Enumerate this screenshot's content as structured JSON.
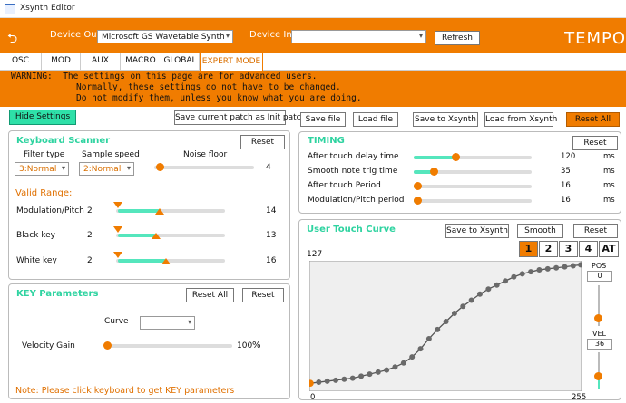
{
  "window": {
    "title": "Xsynth Editor"
  },
  "header": {
    "device_out_label": "Device Out:",
    "device_out_value": "Microsoft GS Wavetable Synth",
    "device_in_label": "Device In:",
    "device_in_value": "",
    "refresh_label": "Refresh",
    "brand": "TEMPO"
  },
  "tabs": [
    "OSC",
    "MOD",
    "AUX",
    "MACRO",
    "GLOBAL",
    "EXPERT MODE"
  ],
  "warning": {
    "line1": "WARNING:  The settings on this page are for advanced users.",
    "line2": "Normally, these settings do not have to be changed.",
    "line3": "Do not modify them, unless you know what you are doing."
  },
  "toolbar": {
    "hide_settings": "Hide Settings",
    "save_init": "Save current patch as Init patch",
    "save_file": "Save file",
    "load_file": "Load file",
    "save_xsynth": "Save to Xsynth",
    "load_xsynth": "Load from Xsynth",
    "reset_all": "Reset All"
  },
  "keyboard_scanner": {
    "title": "Keyboard Scanner",
    "reset": "Reset",
    "filter_type_label": "Filter type",
    "filter_type_value": "3:Normal",
    "sample_speed_label": "Sample speed",
    "sample_speed_value": "2:Normal",
    "noise_floor_label": "Noise floor",
    "noise_floor_value": "4",
    "noise_floor_level": 0.05,
    "valid_range_label": "Valid Range:",
    "ranges": [
      {
        "label": "Modulation/Pitch",
        "min": "2",
        "max": "14",
        "min_level": 0.02,
        "max_level": 0.4
      },
      {
        "label": "Black key",
        "min": "2",
        "max": "13",
        "min_level": 0.02,
        "max_level": 0.37
      },
      {
        "label": "White key",
        "min": "2",
        "max": "16",
        "min_level": 0.02,
        "max_level": 0.46
      }
    ]
  },
  "key_parameters": {
    "title": "KEY Parameters",
    "reset_all": "Reset All",
    "reset": "Reset",
    "curve_label": "Curve",
    "curve_value": "",
    "velocity_gain_label": "Velocity Gain",
    "velocity_gain_value": "100",
    "velocity_gain_unit": "%",
    "velocity_gain_level": 0.0,
    "note": "Note: Please click keyboard to get KEY parameters"
  },
  "timing": {
    "title": "TIMING",
    "reset": "Reset",
    "rows": [
      {
        "label": "After touch delay time",
        "value": "120",
        "unit": "ms",
        "level": 0.35
      },
      {
        "label": "Smooth note trig time",
        "value": "35",
        "unit": "ms",
        "level": 0.17
      },
      {
        "label": "After touch Period",
        "value": "16",
        "unit": "ms",
        "level": 0.03
      },
      {
        "label": "Modulation/Pitch period",
        "value": "16",
        "unit": "ms",
        "level": 0.03
      }
    ]
  },
  "touch_curve": {
    "title": "User Touch Curve",
    "save_xsynth": "Save to Xsynth",
    "smooth": "Smooth",
    "reset": "Reset",
    "curve_buttons": [
      "1",
      "2",
      "3",
      "4",
      "AT"
    ],
    "selected_curve": "1",
    "y_max_label": "127",
    "x_min_label": "0",
    "x_max_label": "255",
    "pos_label": "POS",
    "pos_value": "0",
    "vel_label": "VEL",
    "vel_value": "36",
    "points": [
      [
        0,
        7
      ],
      [
        8,
        8
      ],
      [
        16,
        9
      ],
      [
        24,
        10
      ],
      [
        32,
        11
      ],
      [
        40,
        12
      ],
      [
        48,
        14
      ],
      [
        56,
        16
      ],
      [
        64,
        18
      ],
      [
        72,
        20
      ],
      [
        80,
        23
      ],
      [
        88,
        27
      ],
      [
        96,
        33
      ],
      [
        104,
        41
      ],
      [
        112,
        51
      ],
      [
        120,
        60
      ],
      [
        128,
        68
      ],
      [
        136,
        76
      ],
      [
        144,
        83
      ],
      [
        152,
        89
      ],
      [
        160,
        95
      ],
      [
        168,
        100
      ],
      [
        176,
        104
      ],
      [
        184,
        108
      ],
      [
        192,
        112
      ],
      [
        200,
        115
      ],
      [
        208,
        117
      ],
      [
        216,
        119
      ],
      [
        224,
        120
      ],
      [
        232,
        121
      ],
      [
        240,
        122
      ],
      [
        248,
        123
      ],
      [
        255,
        124
      ]
    ]
  },
  "colors": {
    "accent": "#f07c00",
    "teal": "#2ed3a0",
    "slider_fill": "#55e6bd"
  }
}
